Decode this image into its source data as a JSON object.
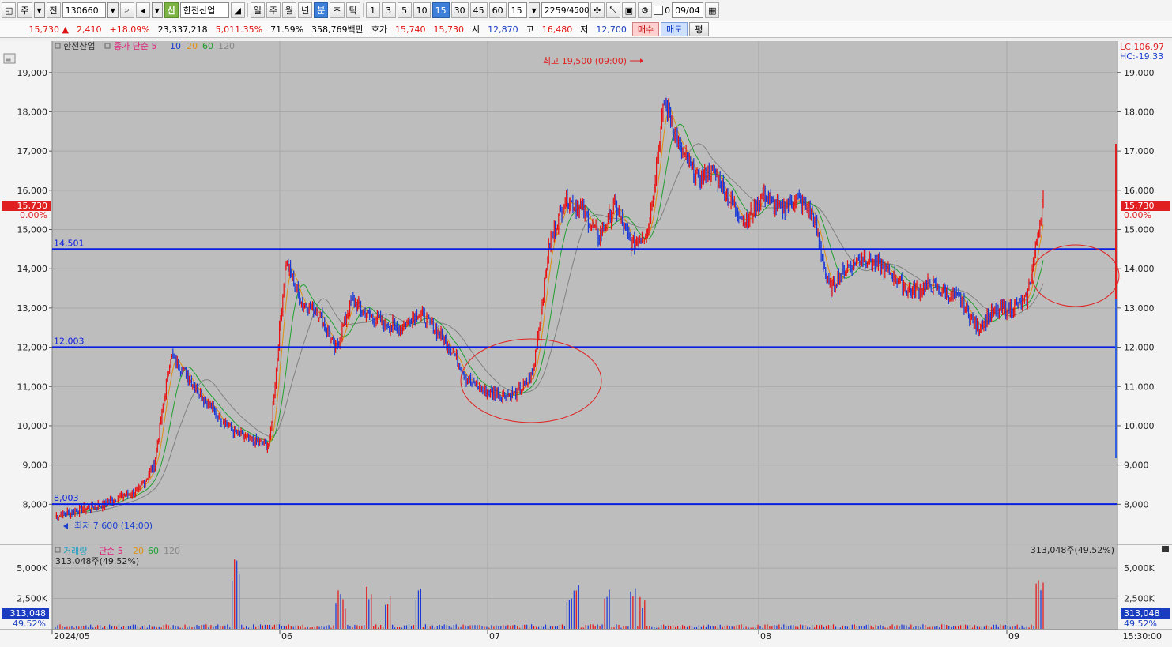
{
  "toolbar": {
    "market": "주",
    "prev_label": "전",
    "code": "130660",
    "new_badge": "신",
    "stock_name": "한전산업",
    "periods": [
      "일",
      "주",
      "월",
      "년",
      "분",
      "초",
      "틱"
    ],
    "active_period": "분",
    "minutes": [
      "1",
      "3",
      "5",
      "10",
      "15",
      "30",
      "45",
      "60"
    ],
    "active_minute": "15",
    "minute_value": "15",
    "count": "2259",
    "count_total": "/4500",
    "zero_label": "0",
    "date": "09/04"
  },
  "quote": {
    "price": "15,730",
    "change_arrow": "▲",
    "change": "2,410",
    "change_pct": "+18.09%",
    "volume": "23,337,218",
    "volume_pct": "5,011.35%",
    "turnover": "71.59%",
    "amount": "358,769백만",
    "ask_label": "호가",
    "ask1": "15,740",
    "ask2": "15,730",
    "open_label": "시",
    "open": "12,870",
    "high_label": "고",
    "high": "16,480",
    "low_label": "저",
    "low": "12,700",
    "buy_label": "매수",
    "sell_label": "매도",
    "avg_label": "평"
  },
  "price_panel": {
    "legend_name": "한전산업",
    "legend_ma": "종가 단순 5",
    "ma_periods": [
      "10",
      "20",
      "60",
      "120"
    ],
    "lc_label": "LC:106.97",
    "hc_label": "HC:-19.33",
    "current_price_tag": "15,730",
    "current_pct_tag": "0.00%",
    "high_annotation": "최고 19,500 (09:00)",
    "low_annotation": "최저 7,600 (14:00)",
    "hlines": [
      {
        "label": "14,501",
        "value": 14501
      },
      {
        "label": "12,003",
        "value": 12003
      },
      {
        "label": "8,003",
        "value": 8003
      }
    ],
    "y_ticks": [
      "19,000",
      "18,000",
      "17,000",
      "16,000",
      "15,000",
      "14,000",
      "13,000",
      "12,000",
      "11,000",
      "10,000",
      "9,000",
      "8,000"
    ]
  },
  "volume_panel": {
    "legend_name": "거래량",
    "legend_ma": "단순 5",
    "ma_periods": [
      "20",
      "60",
      "120"
    ],
    "last_value": "313,048주(49.52%)",
    "tag_value": "313,048",
    "tag_pct": "49.52%",
    "y_ticks": [
      "5,000K",
      "2,500K"
    ]
  },
  "x_axis": {
    "labels": [
      "2024/05",
      "06",
      "07",
      "08",
      "09"
    ],
    "time": "15:30:00"
  },
  "chart_data": {
    "type": "line",
    "ylim": [
      7000,
      19800
    ],
    "series": [
      {
        "name": "종가",
        "x_months": [
          "2024/05",
          "06",
          "07",
          "08",
          "09"
        ],
        "values": [
          7700,
          7800,
          7900,
          8000,
          8200,
          8300,
          9000,
          11800,
          11300,
          10700,
          10200,
          9800,
          9600,
          9500,
          14200,
          13100,
          12900,
          11900,
          13200,
          12800,
          12600,
          12500,
          12900,
          12500,
          12000,
          11200,
          10900,
          10800,
          10800,
          11300,
          14600,
          15800,
          15500,
          14800,
          15600,
          14600,
          15000,
          18300,
          17000,
          16300,
          16500,
          15700,
          15200,
          15900,
          15500,
          15800,
          15400,
          13500,
          14000,
          14300,
          14100,
          13800,
          13400,
          13600,
          13400,
          13200,
          12500,
          12900,
          13000,
          13200,
          15730
        ]
      }
    ],
    "volume_peaks_k": [
      6000,
      6200,
      3500,
      2500,
      4000,
      3000,
      3500,
      2500,
      4000,
      3800,
      3500,
      2800,
      4500
    ]
  }
}
